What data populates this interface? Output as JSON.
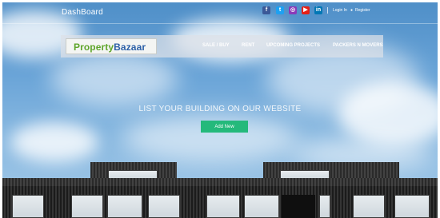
{
  "topbar": {
    "title": "DashBoard",
    "social_icons": [
      {
        "name": "facebook-icon",
        "glyph": "f",
        "color": "#3b5998"
      },
      {
        "name": "twitter-icon",
        "glyph": "t",
        "color": "#1da1f2"
      },
      {
        "name": "instagram-icon",
        "glyph": "◎",
        "color": "#8a3ab9"
      },
      {
        "name": "youtube-icon",
        "glyph": "▶",
        "color": "#e62117"
      },
      {
        "name": "linkedin-icon",
        "glyph": "in",
        "color": "#0077b5"
      }
    ],
    "login_label": "Login In",
    "register_label": "Register"
  },
  "nav": {
    "logo_part1": "Property",
    "logo_part2": "Bazaar",
    "items": [
      "SALE / BUY",
      "RENT",
      "UPCOMING PROJECTS",
      "PACKERS N MOVERS"
    ]
  },
  "hero": {
    "headline": "LIST YOUR BUILDING ON OUR WEBSITE",
    "button_label": "Add New"
  },
  "colors": {
    "accent_button": "#24b97b",
    "logo_green": "#5ea52a",
    "logo_blue": "#2b5fa7"
  }
}
